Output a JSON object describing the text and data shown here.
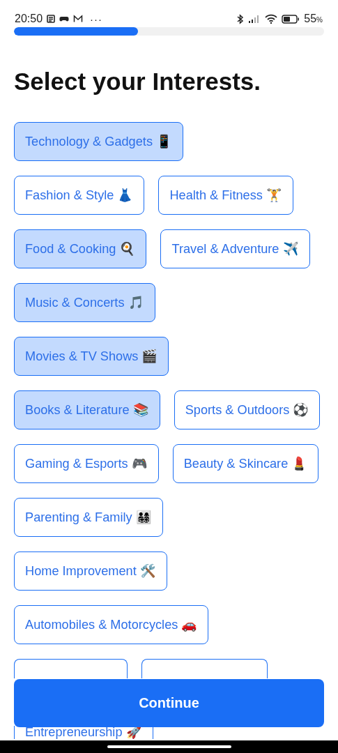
{
  "status_bar": {
    "time": "20:50",
    "more": "···",
    "battery_text": "55",
    "battery_unit": "%"
  },
  "progress": {
    "level": 0.4
  },
  "title": "Select your Interests.",
  "interests": [
    {
      "label": "Technology & Gadgets 📱",
      "selected": true
    },
    {
      "label": "Fashion & Style 👗",
      "selected": false
    },
    {
      "label": "Health & Fitness 🏋",
      "selected": false
    },
    {
      "label": "Food & Cooking 🍳",
      "selected": true
    },
    {
      "label": "Travel & Adventure ✈️",
      "selected": false
    },
    {
      "label": "Music & Concerts 🎵",
      "selected": true
    },
    {
      "label": "Movies & TV Shows 🎬",
      "selected": true
    },
    {
      "label": "Books & Literature 📚",
      "selected": true
    },
    {
      "label": "Sports & Outdoors ⚽",
      "selected": false
    },
    {
      "label": "Gaming & Esports 🎮",
      "selected": false
    },
    {
      "label": "Beauty & Skincare 💄",
      "selected": false
    },
    {
      "label": "Parenting & Family 👨‍👩‍👧‍👦",
      "selected": false
    },
    {
      "label": "Home Improvement 🛠️",
      "selected": false
    },
    {
      "label": "Automobiles & Motorcycles 🚗",
      "selected": false
    },
    {
      "selected": false
    },
    {
      "selected": false
    },
    {
      "label": "Entrepreneurship 🚀",
      "selected": false
    }
  ],
  "continue_button": "Continue"
}
